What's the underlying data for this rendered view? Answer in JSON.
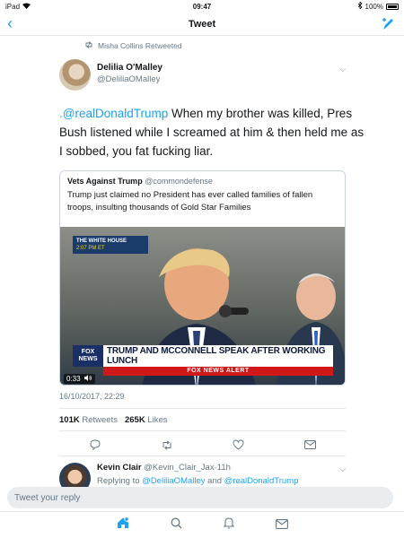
{
  "status_bar": {
    "device": "iPad",
    "time": "09:47",
    "battery": "100%"
  },
  "navbar": {
    "title": "Tweet"
  },
  "retweet_context": {
    "text": "Misha Collins Retweeted"
  },
  "tweet": {
    "author_name": "Delilia O'Malley",
    "author_handle": "@DeliliaOMalley",
    "mention": ".@realDonaldTrump",
    "body": " When my brother was killed, Pres Bush listened while I screamed at him & then held me as I sobbed, you fat fucking liar.",
    "timestamp": "16/10/2017, 22:29",
    "retweets_count": "101K",
    "retweets_label": "Retweets",
    "likes_count": "265K",
    "likes_label": "Likes"
  },
  "quoted_tweet": {
    "name": "Vets Against Trump",
    "handle": "@commondefense",
    "text": "Trump just claimed no President has ever called families of fallen troops, insulting thousands of Gold Star Families",
    "video": {
      "badge_title": "THE WHITE HOUSE",
      "badge_time": "2:07 PM ET",
      "network_line1": "FOX",
      "network_line2": "NEWS",
      "headline": "TRUMP AND MCCONNELL SPEAK AFTER WORKING LUNCH",
      "alert": "FOX NEWS ALERT",
      "duration": "0:33"
    }
  },
  "reply": {
    "name": "Kevin Clair",
    "handle": "@Kevin_Clair_Jax",
    "age": "11h",
    "replying_prefix": "Replying to",
    "replying_to_1": "@DeliliaOMalley",
    "replying_and": "and",
    "replying_to_2": "@realDonaldTrump"
  },
  "composer": {
    "placeholder": "Tweet your reply"
  },
  "colors": {
    "accent": "#1da1f2",
    "secondary_text": "#657786",
    "border": "#e1e8ed"
  },
  "tabbar": {
    "items": [
      "home-icon",
      "search-icon",
      "notifications-icon",
      "messages-icon"
    ]
  }
}
